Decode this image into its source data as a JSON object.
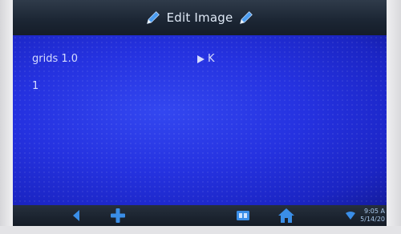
{
  "header": {
    "title": "Edit Image"
  },
  "content": {
    "row1": {
      "label": "grids 1.0",
      "value": "K"
    },
    "row2": {
      "value": "1"
    }
  },
  "navbar": {
    "icons": [
      "back-arrow-icon",
      "plus-icon",
      "screen-toggle-icon",
      "home-icon",
      "wifi-icon"
    ],
    "status": {
      "time": "9:05 A",
      "date": "5/14/20"
    }
  },
  "colors": {
    "accent": "#3a8ee8",
    "content_bg": "#2532e0",
    "text": "#d6dcff",
    "bar": "#1b2533"
  }
}
